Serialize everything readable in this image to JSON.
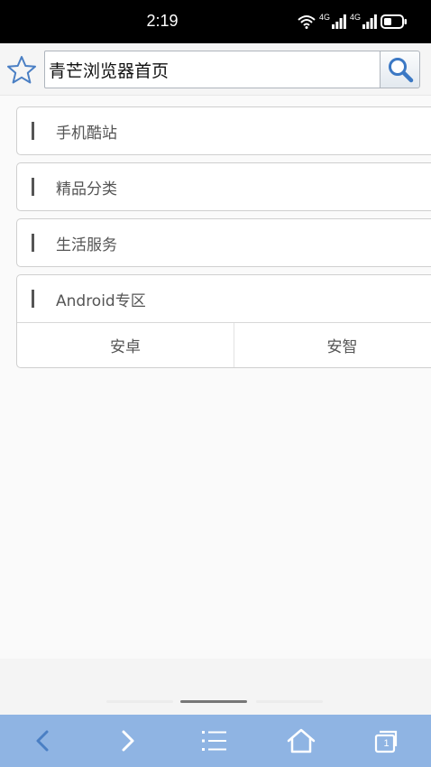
{
  "status_bar": {
    "time": "2:19",
    "net1": "4G",
    "net2": "4G",
    "icons": [
      "wifi-icon",
      "signal-icon",
      "signal-icon",
      "battery-icon"
    ]
  },
  "address_bar": {
    "url_value": "青芒浏览器首页",
    "star_icon": "star-outline-icon",
    "search_icon": "magnifier-icon"
  },
  "categories": [
    {
      "label": "手机酷站"
    },
    {
      "label": "精品分类"
    },
    {
      "label": "生活服务"
    },
    {
      "label": "Android专区",
      "subitems": [
        "安卓",
        "安智"
      ]
    }
  ],
  "toolbar": {
    "tab_count": "1",
    "icons": [
      "back-icon",
      "forward-icon",
      "menu-icon",
      "home-icon",
      "tabs-icon"
    ]
  },
  "colors": {
    "toolbar_bg": "#8fb4e3",
    "accent_blue": "#4a7fc4"
  }
}
